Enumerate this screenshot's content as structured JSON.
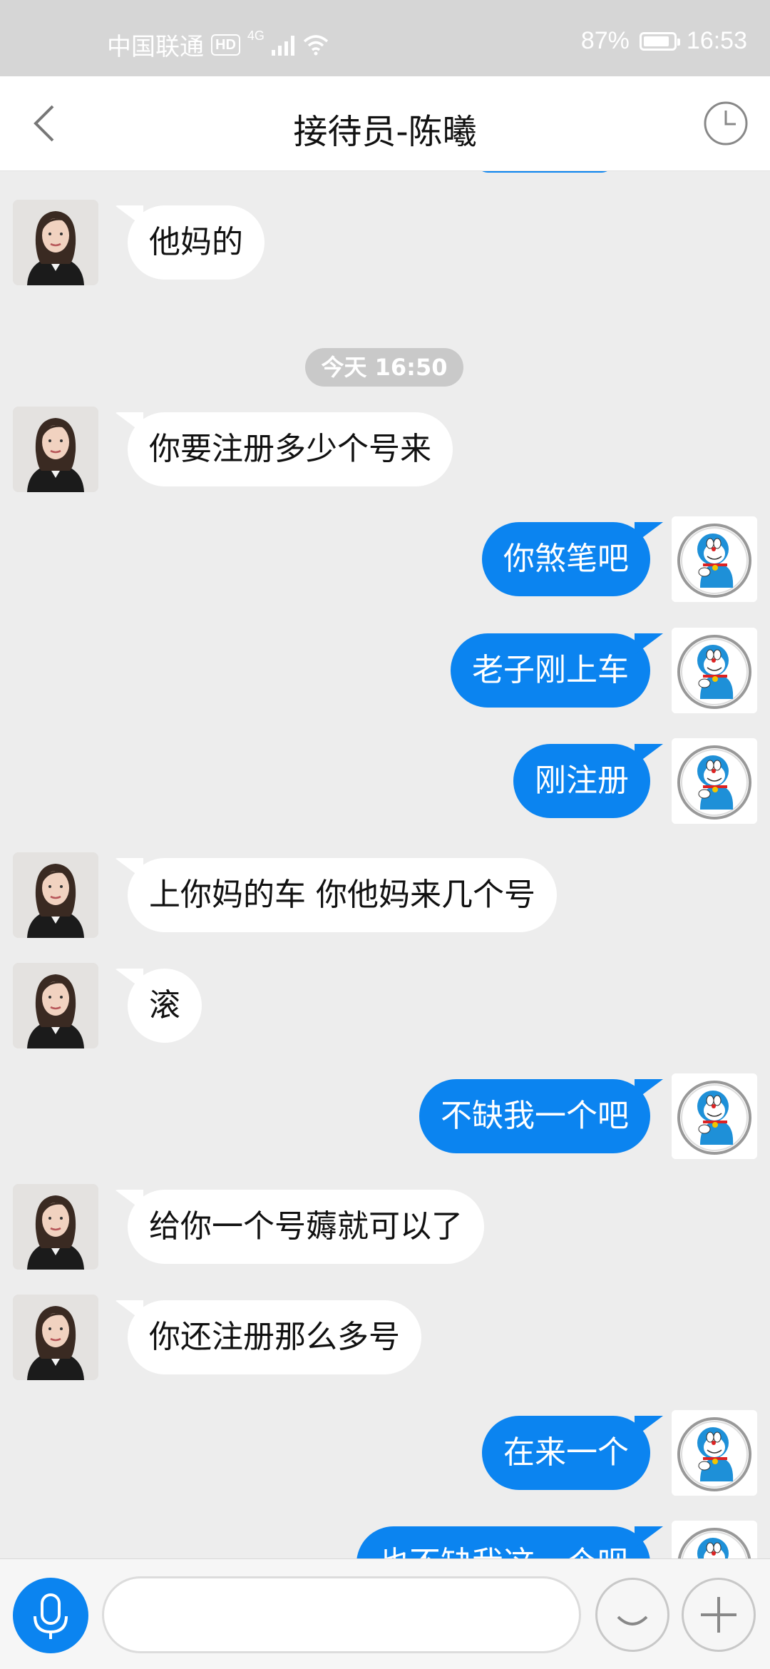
{
  "status_bar": {
    "carrier": "中国联通",
    "hd": "HD",
    "network": "4G",
    "battery": "87%",
    "battery_level": 0.87,
    "time": "16:53"
  },
  "header": {
    "title": "接待员-陈曦",
    "back_icon": "chevron-left-icon",
    "history_icon": "clock-icon"
  },
  "chat": {
    "timestamp": "今天 16:50",
    "messages": [
      {
        "side": "left",
        "text": "他妈的"
      },
      {
        "side": "left",
        "text": "你要注册多少个号来"
      },
      {
        "side": "right",
        "text": "你煞笔吧"
      },
      {
        "side": "right",
        "text": "老子刚上车"
      },
      {
        "side": "right",
        "text": "刚注册"
      },
      {
        "side": "left",
        "text": "上你妈的车 你他妈来几个号"
      },
      {
        "side": "left",
        "text": "滚"
      },
      {
        "side": "right",
        "text": "不缺我一个吧"
      },
      {
        "side": "left",
        "text": "给你一个号薅就可以了"
      },
      {
        "side": "left",
        "text": "你还注册那么多号"
      },
      {
        "side": "right",
        "text": "在来一个"
      },
      {
        "side": "right",
        "text": "也不缺我这一个呗"
      }
    ]
  },
  "input_bar": {
    "placeholder": "",
    "mic_icon": "microphone-icon",
    "emoji_icon": "smiley-icon",
    "more_icon": "plus-icon"
  },
  "colors": {
    "accent": "#0b84f0",
    "background": "#ededed",
    "incoming_bubble": "#ffffff"
  }
}
